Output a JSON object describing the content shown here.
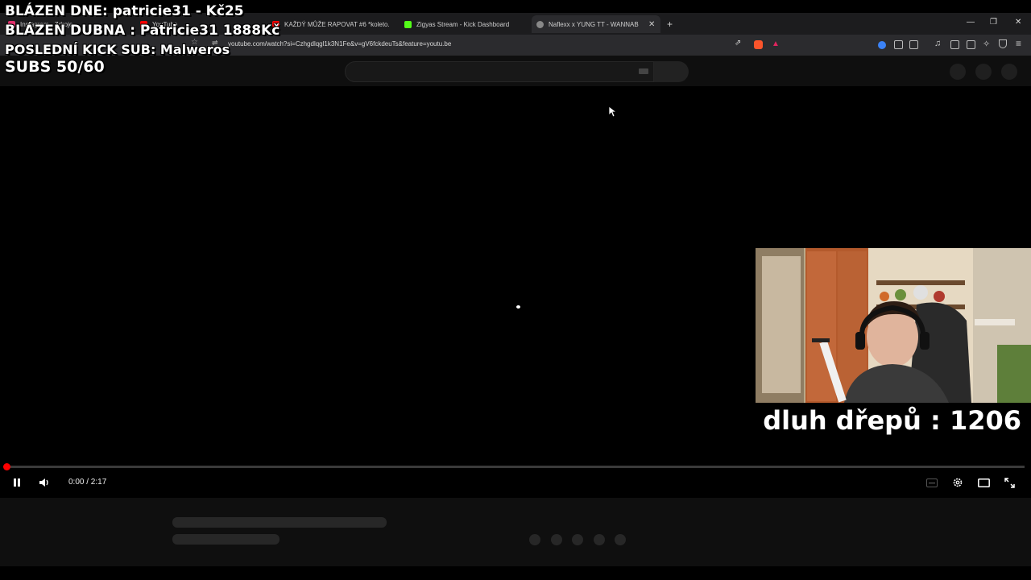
{
  "browser": {
    "tabs": [
      {
        "label": "Instagram - Zdroje",
        "color": "#e1306c"
      },
      {
        "label": "YouTube",
        "color": "#ff0000"
      },
      {
        "label": "KAŽDÝ MŮŽE RAPOVAT #6 *koleto...",
        "color": "#ff0000"
      },
      {
        "label": "Zigyas Stream - Kick Dashboard",
        "color": "#53fc18"
      },
      {
        "label": "Naflexx x YUNG TT - WANNABE",
        "color": "#888888"
      }
    ],
    "new_tab": "+",
    "url": "youtube.com/watch?si=Czhgdlqgl1k3N1Fe&v=gV6fckdeuTs&feature=youtu.be"
  },
  "overlay": {
    "line1": "BLÁZEN DNE: patricie31 - Kč25",
    "line2": "BLÁZEN DUBNA : Patricie31 1888Kč",
    "line3": "POSLEDNÍ KICK SUB: Malweros",
    "line4": "SUBS 50/60",
    "squats": "dluh dřepů : 1206"
  },
  "player": {
    "time": "0:00 / 2:17",
    "progress": 0.0
  },
  "colors": {
    "progress": "#ff0000",
    "chrome": "#1c1c1e"
  }
}
